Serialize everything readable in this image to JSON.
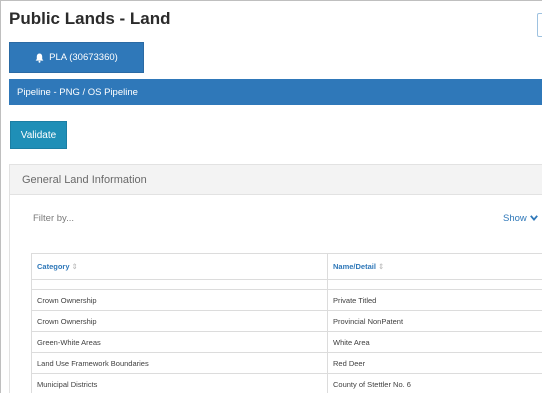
{
  "header": {
    "title": "Public Lands - Land"
  },
  "pla_button": {
    "label": "PLA (30673360)",
    "icon": "bell-icon"
  },
  "pipeline_bar": {
    "label": "Pipeline - PNG / OS Pipeline"
  },
  "validate_button": {
    "label": "Validate"
  },
  "panel": {
    "title": "General Land Information",
    "filter_label": "Filter by...",
    "show_label": "Show",
    "table": {
      "columns": [
        "Category",
        "Name/Detail"
      ],
      "rows": [
        [
          "Crown Ownership",
          "Private Titled"
        ],
        [
          "Crown Ownership",
          "Provincial NonPatent"
        ],
        [
          "Green-White Areas",
          "White Area"
        ],
        [
          "Land Use Framework Boundaries",
          "Red Deer"
        ],
        [
          "Municipal Districts",
          "County of Stettler No. 6"
        ]
      ]
    }
  },
  "colors": {
    "primary": "#2f78b9",
    "validate": "#1f8fb7",
    "header_bg": "#f3f3f3",
    "link": "#2f78b9"
  }
}
